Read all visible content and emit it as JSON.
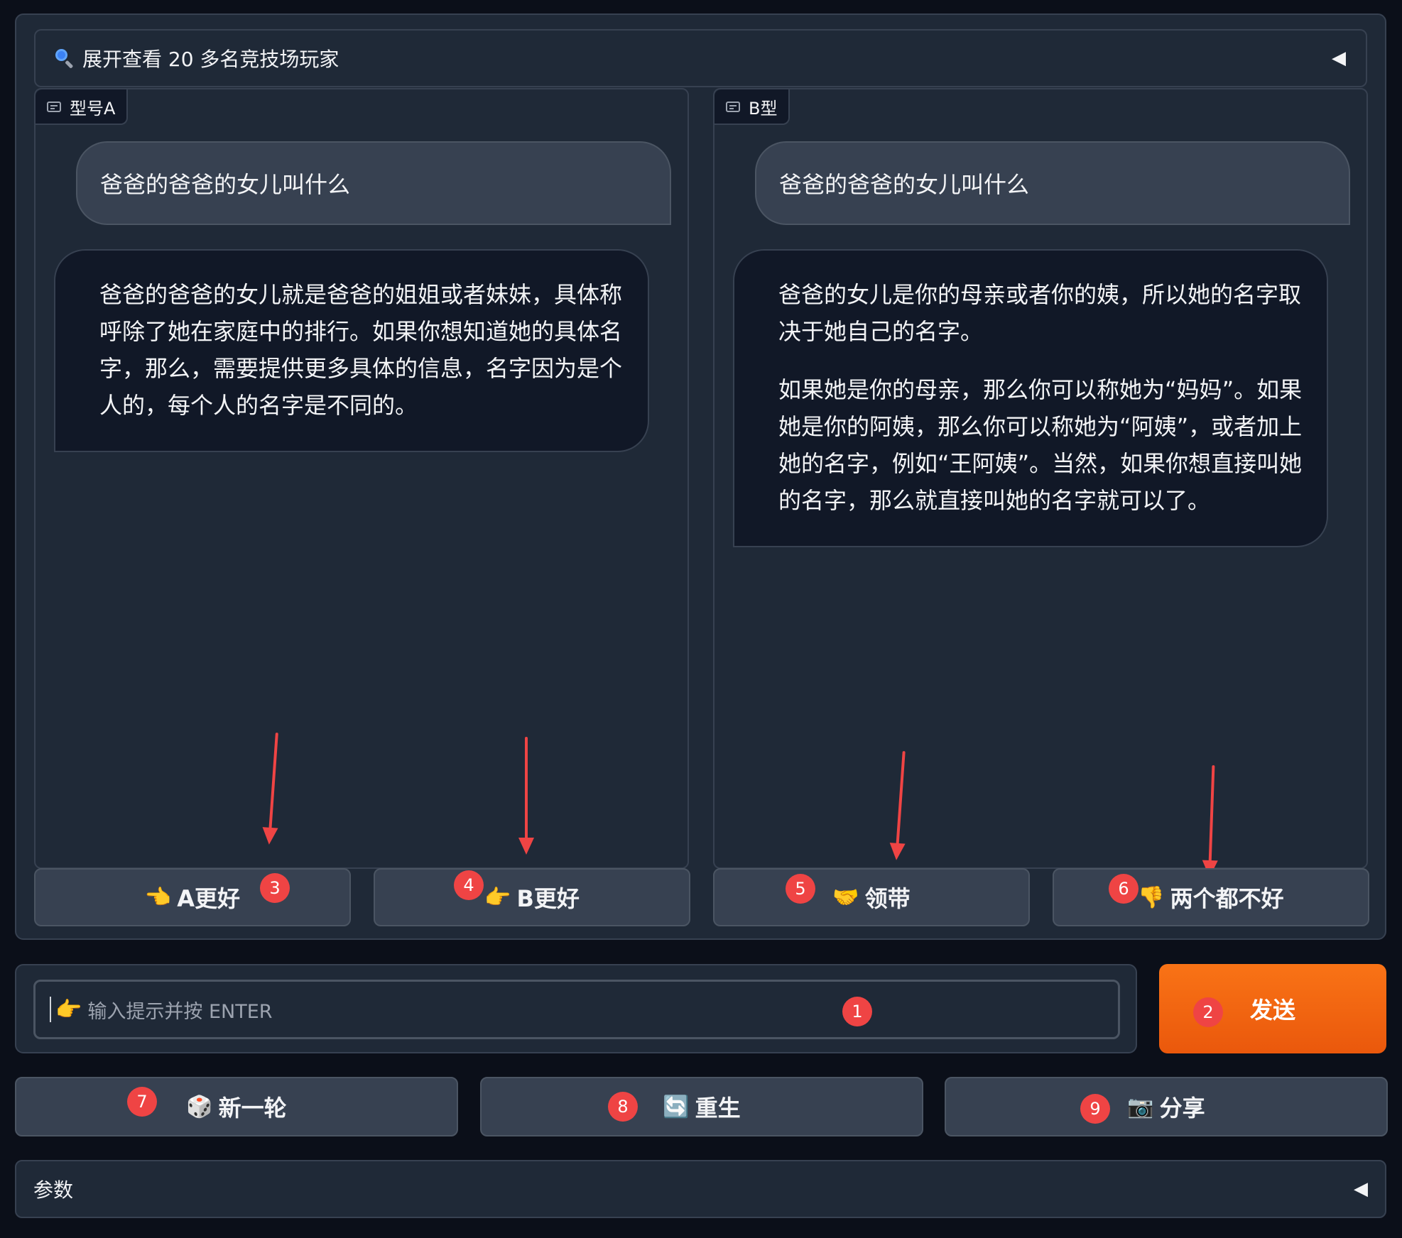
{
  "accordion": {
    "label": "展开查看 20 多名竞技场玩家",
    "caret": "◀"
  },
  "panel_a": {
    "label": "型号A",
    "user_message": "爸爸的爸爸的女儿叫什么",
    "bot_paragraphs": [
      "爸爸的爸爸的女儿就是爸爸的姐姐或者妹妹，具体称呼除了她在家庭中的排行。如果你想知道她的具体名字，那么，需要提供更多具体的信息，名字因为是个人的，每个人的名字是不同的。"
    ]
  },
  "panel_b": {
    "label": "B型",
    "user_message": "爸爸的爸爸的女儿叫什么",
    "bot_paragraphs": [
      "爸爸的女儿是你的母亲或者你的姨，所以她的名字取决于她自己的名字。",
      "如果她是你的母亲，那么你可以称她为“妈妈”。如果她是你的阿姨，那么你可以称她为“阿姨”，或者加上她的名字，例如“王阿姨”。当然，如果你想直接叫她的名字，那么就直接叫她的名字就可以了。"
    ]
  },
  "vote": {
    "a_better": "A更好",
    "b_better": "B更好",
    "tie": "领带",
    "both_bad": "两个都不好"
  },
  "icons": {
    "a_better": "👈",
    "b_better": "👉",
    "tie": "🤝",
    "both_bad": "👎",
    "input": "👉",
    "new_round": "🎲",
    "regenerate": "🔄",
    "share": "📷"
  },
  "input": {
    "placeholder": "输入提示并按 ENTER"
  },
  "send_label": "发送",
  "actions": {
    "new_round": "新一轮",
    "regenerate": "重生",
    "share": "分享"
  },
  "params": {
    "label": "参数",
    "caret": "◀"
  },
  "badges": [
    "1",
    "2",
    "3",
    "4",
    "5",
    "6",
    "7",
    "8",
    "9"
  ],
  "colors": {
    "accent": "#f97316",
    "badge": "#ef4444",
    "panel": "#1f2937",
    "background": "#0b0f19"
  }
}
